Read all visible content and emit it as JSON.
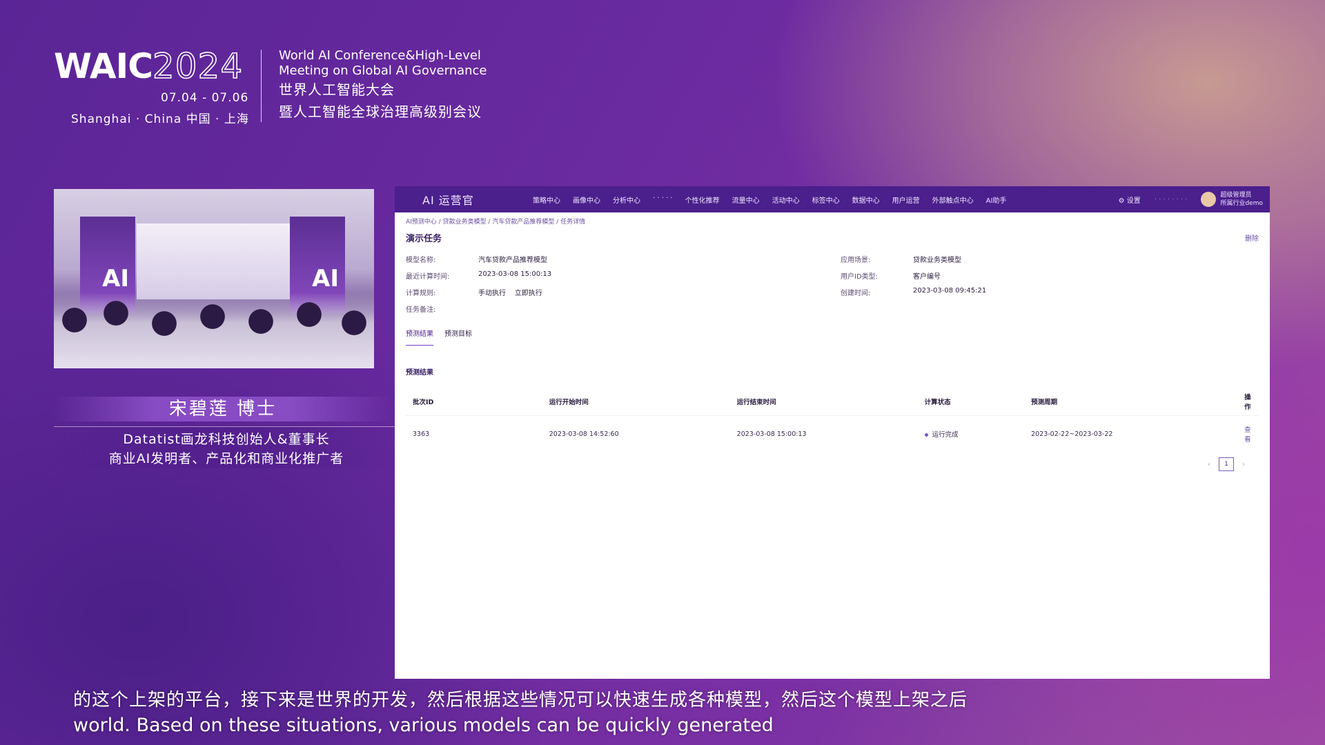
{
  "conference": {
    "logo_word": "WAIC",
    "logo_year": "2024",
    "dates": "07.04 - 07.06",
    "city": "Shanghai · China  中国 · 上海",
    "title_en_line1": "World AI Conference&High-Level",
    "title_en_line2": "Meeting on Global AI Governance",
    "title_cn_line1": "世界人工智能大会",
    "title_cn_line2": "暨人工智能全球治理高级别会议"
  },
  "speaker": {
    "name": "宋碧莲  博士",
    "desc_line1": "Datatist画龙科技创始人&董事长",
    "desc_line2": "商业AI发明者、产品化和商业化推广者"
  },
  "app": {
    "brand": "AI 运营官",
    "nav": [
      "策略中心",
      "画像中心",
      "分析中心",
      "· · · · ·",
      "个性化推荐",
      "流量中心",
      "活动中心",
      "标签中心",
      "数据中心",
      "用户运营",
      "外部触点中心",
      "AI助手"
    ],
    "settings": "设置",
    "blur_text": "· · · · · · · ·",
    "user_line1": "超级管理员",
    "user_line2": "所属行业demo",
    "breadcrumb": "AI预测中心 / 贷款业务类模型 / 汽车贷款产品推荐模型 / 任务详情",
    "page_title": "演示任务",
    "delete_label": "删除",
    "info": {
      "model_name_label": "模型名称:",
      "model_name": "汽车贷款产品推荐模型",
      "scenario_label": "应用场景:",
      "scenario": "贷款业务类模型",
      "last_calc_label": "最近计算时间:",
      "last_calc": "2023-03-08 15:00:13",
      "user_id_label": "用户ID类型:",
      "user_id": "客户编号",
      "rule_label": "计算规则:",
      "rule_manual": "手动执行",
      "rule_now": "立即执行",
      "created_label": "创建时间:",
      "created": "2023-03-08 09:45:21",
      "remark_label": "任务备注:"
    },
    "tabs": [
      "预测结果",
      "预测目标"
    ],
    "section_title": "预测结果",
    "table": {
      "headers": [
        "批次ID",
        "运行开始时间",
        "运行结束时间",
        "计算状态",
        "预测周期",
        "操作"
      ],
      "rows": [
        [
          "3363",
          "2023-03-08 14:52:60",
          "2023-03-08 15:00:13",
          "运行完成",
          "2023-02-22~2023-03-22",
          "查看"
        ]
      ]
    },
    "pager": {
      "prev": "‹",
      "page": "1",
      "next": "›"
    }
  },
  "subtitles": {
    "cn": "的这个上架的平台，接下来是世界的开发，然后根据这些情况可以快速生成各种模型，然后这个模型上架之后",
    "en": "world. Based on these situations, various models can be quickly generated"
  }
}
